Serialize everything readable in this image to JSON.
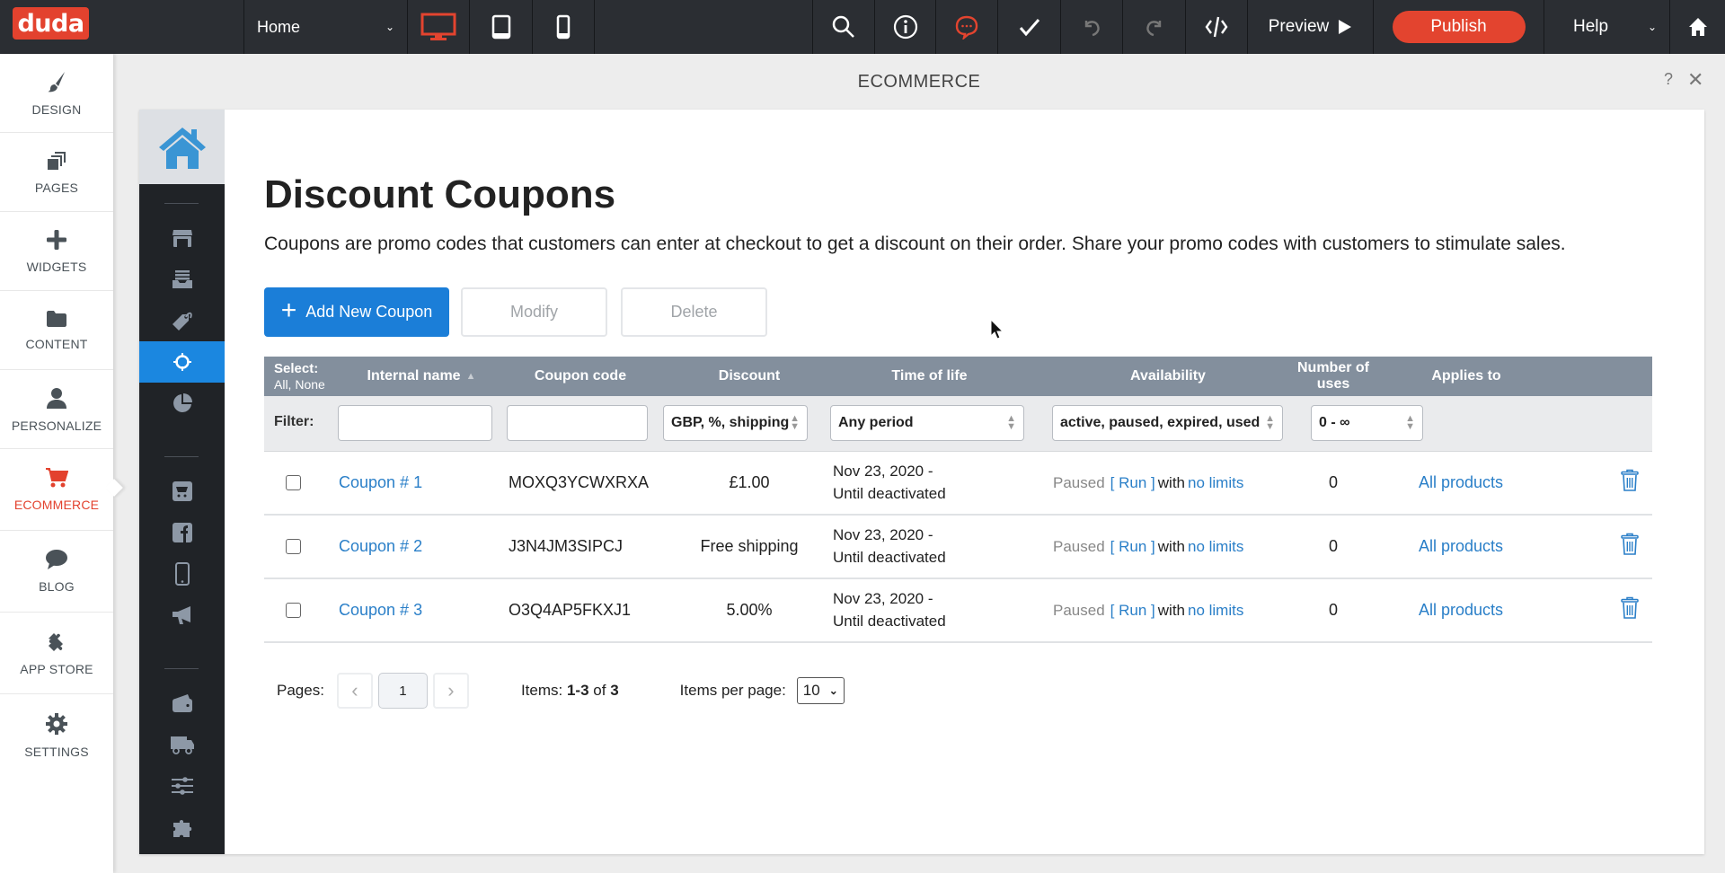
{
  "topbar": {
    "logo": "duda",
    "page_select": "Home",
    "devices": [
      {
        "name": "desktop",
        "active": true
      },
      {
        "name": "tablet",
        "active": false
      },
      {
        "name": "mobile",
        "active": false
      }
    ],
    "tools": [
      "search-icon",
      "info-icon",
      "comments-icon",
      "check-icon",
      "undo-icon",
      "redo-icon",
      "code-icon"
    ],
    "preview_label": "Preview",
    "publish_label": "Publish",
    "help_label": "Help",
    "accent_color": "#e3442f"
  },
  "sidebar": {
    "items": [
      {
        "label": "DESIGN",
        "icon": "brush-icon",
        "active": false
      },
      {
        "label": "PAGES",
        "icon": "pages-icon",
        "active": false
      },
      {
        "label": "WIDGETS",
        "icon": "plus-icon",
        "active": false
      },
      {
        "label": "CONTENT",
        "icon": "folder-icon",
        "active": false
      },
      {
        "label": "PERSONALIZE",
        "icon": "user-icon",
        "active": false
      },
      {
        "label": "ECOMMERCE",
        "icon": "cart-icon",
        "active": true
      },
      {
        "label": "BLOG",
        "icon": "chat-bubble-icon",
        "active": false
      },
      {
        "label": "APP STORE",
        "icon": "puzzle-icon",
        "active": false
      },
      {
        "label": "SETTINGS",
        "icon": "gear-icon",
        "active": false
      }
    ]
  },
  "panel": {
    "title": "ECOMMERCE",
    "help": "?",
    "close": "✕"
  },
  "rail": {
    "items": [
      "home-icon",
      "store-icon",
      "inbox-icon",
      "tag-icon",
      "target-icon",
      "pie-chart-icon",
      "cart-box-icon",
      "facebook-icon",
      "mobile-icon",
      "megaphone-icon",
      "wallet-icon",
      "truck-icon",
      "sliders-icon",
      "puzzle-icon"
    ],
    "active": "target-icon"
  },
  "main": {
    "title": "Discount Coupons",
    "description": "Coupons are promo codes that customers can enter at checkout to get a discount on their order. Share your promo codes with customers to stimulate sales.",
    "buttons": {
      "add": "Add New Coupon",
      "modify": "Modify",
      "delete": "Delete"
    },
    "table": {
      "select_label": "Select:",
      "select_options": "All, None",
      "columns": {
        "name": "Internal name",
        "code": "Coupon code",
        "discount": "Discount",
        "life": "Time of life",
        "availability": "Availability",
        "uses": "Number of uses",
        "applies": "Applies to"
      },
      "filter": {
        "label": "Filter:",
        "name_value": "",
        "code_value": "",
        "discount_value": "GBP, %, shipping",
        "life_value": "Any period",
        "availability_value": "active, paused, expired, used",
        "uses_value": "0 - ∞"
      },
      "rows": [
        {
          "name": "Coupon # 1",
          "code": "MOXQ3YCWXRXA",
          "discount": "£1.00",
          "life_start": "Nov 23, 2020 -",
          "life_end": "Until deactivated",
          "status": "Paused",
          "run": "[ Run ]",
          "with": "with",
          "limits": "no limits",
          "uses": "0",
          "applies": "All products"
        },
        {
          "name": "Coupon # 2",
          "code": "J3N4JM3SIPCJ",
          "discount": "Free shipping",
          "life_start": "Nov 23, 2020 -",
          "life_end": "Until deactivated",
          "status": "Paused",
          "run": "[ Run ]",
          "with": "with",
          "limits": "no limits",
          "uses": "0",
          "applies": "All products"
        },
        {
          "name": "Coupon # 3",
          "code": "O3Q4AP5FKXJ1",
          "discount": "5.00%",
          "life_start": "Nov 23, 2020 -",
          "life_end": "Until deactivated",
          "status": "Paused",
          "run": "[ Run ]",
          "with": "with",
          "limits": "no limits",
          "uses": "0",
          "applies": "All products"
        }
      ]
    },
    "pagination": {
      "pages_label": "Pages:",
      "current_page": "1",
      "items_label": "Items:",
      "items_range": "1-3",
      "items_of": "of",
      "items_total": "3",
      "per_page_label": "Items per page:",
      "per_page_value": "10"
    }
  }
}
